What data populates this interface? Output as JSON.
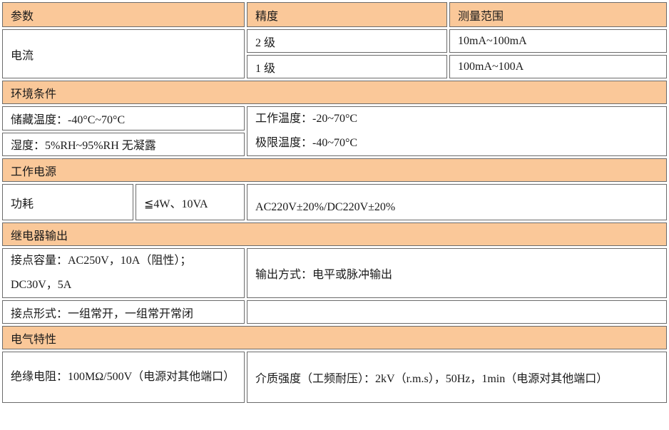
{
  "header": {
    "param": "参数",
    "accuracy": "精度",
    "range": "测量范围"
  },
  "current": {
    "label": "电流",
    "rows": [
      {
        "accuracy": "2 级",
        "range": "10mA~100mA"
      },
      {
        "accuracy": "1 级",
        "range": "100mA~100A"
      }
    ]
  },
  "environment": {
    "title": "环境条件",
    "storage_temp": "储藏温度：-40°C~70°C",
    "humidity": "湿度：5%RH~95%RH 无凝露",
    "working_temp": "工作温度：-20~70°C",
    "limit_temp": "极限温度：-40~70°C"
  },
  "power": {
    "title": "工作电源",
    "label": "功耗",
    "value": "≦4W、10VA",
    "supply": "AC220V±20%/DC220V±20%"
  },
  "relay": {
    "title": "继电器输出",
    "capacity_line1": "接点容量：AC250V，10A（阻性）；",
    "capacity_line2": "DC30V，5A",
    "output_mode": "输出方式：电平或脉冲输出",
    "contact_form": "接点形式：一组常开，一组常开常闭",
    "contact_form_right": ""
  },
  "electrical": {
    "title": "电气特性",
    "insulation": "绝缘电阻：100MΩ/500V（电源对其他端口）",
    "dielectric": "介质强度（工频耐压）：2kV（r.m.s），50Hz，1min（电源对其他端口）"
  }
}
